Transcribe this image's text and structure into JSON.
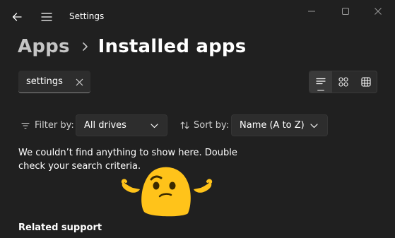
{
  "window": {
    "title": "Settings"
  },
  "breadcrumb": {
    "parent": "Apps",
    "current": "Installed apps"
  },
  "search": {
    "value": "settings"
  },
  "filter": {
    "label": "Filter by:",
    "selected": "All drives"
  },
  "sort": {
    "label": "Sort by:",
    "selected": "Name (A to Z)"
  },
  "view_modes": [
    "list",
    "grid",
    "tiles"
  ],
  "active_view": "list",
  "empty_state": {
    "message": "We couldn’t find anything to show here. Double check your search criteria."
  },
  "related": {
    "title": "Related support"
  },
  "colors": {
    "background": "#202020",
    "control": "#2d2d2d",
    "emoji_yellow": "#ffc31a"
  },
  "icons": [
    "back-arrow-icon",
    "hamburger-menu-icon",
    "minimize-icon",
    "maximize-icon",
    "close-icon",
    "chevron-right-icon",
    "clear-icon",
    "list-view-icon",
    "grid-view-icon",
    "tiles-view-icon",
    "filter-icon",
    "sort-icon",
    "chevron-down-icon",
    "shrug-emoji-icon"
  ]
}
